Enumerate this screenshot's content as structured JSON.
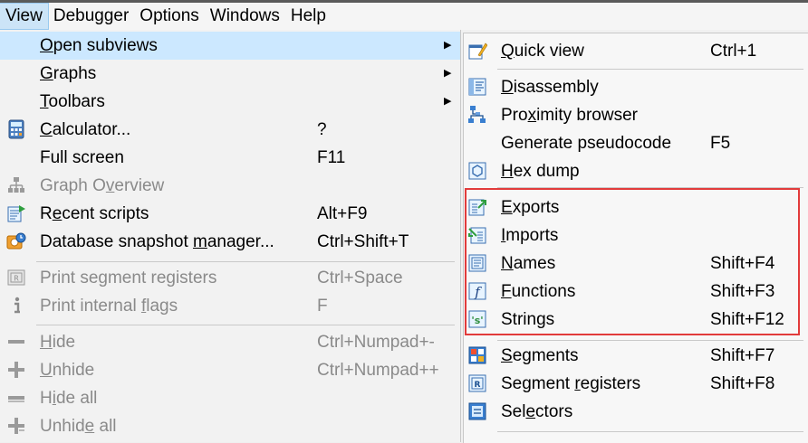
{
  "menubar": [
    {
      "label": "View",
      "active": true
    },
    {
      "label": "Debugger",
      "active": false
    },
    {
      "label": "Options",
      "active": false
    },
    {
      "label": "Windows",
      "active": false
    },
    {
      "label": "Help",
      "active": false
    }
  ],
  "view_menu": [
    {
      "label": "Open subviews",
      "pre": "",
      "u": "O",
      "post": "pen subviews",
      "shortcut": "",
      "submenu": true,
      "highlighted": true,
      "icon": "none-icon",
      "disabled": false
    },
    {
      "label": "Graphs",
      "pre": "",
      "u": "G",
      "post": "raphs",
      "shortcut": "",
      "submenu": true,
      "icon": "none-icon",
      "disabled": false
    },
    {
      "label": "Toolbars",
      "pre": "",
      "u": "T",
      "post": "oolbars",
      "shortcut": "",
      "submenu": true,
      "icon": "none-icon",
      "disabled": false
    },
    {
      "label": "Calculator...",
      "pre": "",
      "u": "C",
      "post": "alculator...",
      "shortcut": "?",
      "icon": "calculator-icon",
      "disabled": false
    },
    {
      "label": "Full screen",
      "pre": "Full screen",
      "u": "",
      "post": "",
      "shortcut": "F11",
      "icon": "none-icon",
      "disabled": false
    },
    {
      "label": "Graph Overview",
      "pre": "Graph O",
      "u": "v",
      "post": "erview",
      "shortcut": "",
      "icon": "graph-overview-icon",
      "disabled": true
    },
    {
      "label": "Recent scripts",
      "pre": "R",
      "u": "e",
      "post": "cent scripts",
      "shortcut": "Alt+F9",
      "icon": "recent-scripts-icon",
      "disabled": false
    },
    {
      "label": "Database snapshot manager...",
      "pre": "Database snapshot ",
      "u": "m",
      "post": "anager...",
      "shortcut": "Ctrl+Shift+T",
      "icon": "snapshot-manager-icon",
      "disabled": false
    },
    {
      "label": "Print segment registers",
      "pre": "Print segment registers",
      "u": "",
      "post": "",
      "shortcut": "Ctrl+Space",
      "icon": "print-segment-registers-icon",
      "disabled": true
    },
    {
      "label": "Print internal flags",
      "pre": "Print internal ",
      "u": "f",
      "post": "lags",
      "shortcut": "F",
      "icon": "info-icon",
      "disabled": true
    },
    {
      "label": "Hide",
      "pre": "",
      "u": "H",
      "post": "ide",
      "shortcut": "Ctrl+Numpad+-",
      "icon": "hide-icon",
      "disabled": true
    },
    {
      "label": "Unhide",
      "pre": "",
      "u": "U",
      "post": "nhide",
      "shortcut": "Ctrl+Numpad++",
      "icon": "unhide-icon",
      "disabled": true
    },
    {
      "label": "Hide all",
      "pre": "H",
      "u": "i",
      "post": "de all",
      "shortcut": "",
      "icon": "hide-all-icon",
      "disabled": true
    },
    {
      "label": "Unhide all",
      "pre": "Unhid",
      "u": "e",
      "post": " all",
      "shortcut": "",
      "icon": "unhide-all-icon",
      "disabled": true
    }
  ],
  "subviews_menu": [
    {
      "label": "Quick view",
      "pre": "",
      "u": "Q",
      "post": "uick view",
      "shortcut": "Ctrl+1",
      "icon": "quick-view-icon"
    },
    {
      "label": "Disassembly",
      "pre": "",
      "u": "D",
      "post": "isassembly",
      "shortcut": "",
      "icon": "disassembly-icon"
    },
    {
      "label": "Proximity browser",
      "pre": "Pro",
      "u": "x",
      "post": "imity browser",
      "shortcut": "",
      "icon": "proximity-browser-icon"
    },
    {
      "label": "Generate pseudocode",
      "pre": "Generate pseudocode",
      "u": "",
      "post": "",
      "shortcut": "F5",
      "icon": "none-icon"
    },
    {
      "label": "Hex dump",
      "pre": "",
      "u": "H",
      "post": "ex dump",
      "shortcut": "",
      "icon": "hex-dump-icon"
    },
    {
      "label": "Exports",
      "pre": "",
      "u": "E",
      "post": "xports",
      "shortcut": "",
      "icon": "exports-icon"
    },
    {
      "label": "Imports",
      "pre": "",
      "u": "I",
      "post": "mports",
      "shortcut": "",
      "icon": "imports-icon"
    },
    {
      "label": "Names",
      "pre": "",
      "u": "N",
      "post": "ames",
      "shortcut": "Shift+F4",
      "icon": "names-icon"
    },
    {
      "label": "Functions",
      "pre": "",
      "u": "F",
      "post": "unctions",
      "shortcut": "Shift+F3",
      "icon": "functions-icon"
    },
    {
      "label": "Strings",
      "pre": "Strin",
      "u": "g",
      "post": "s",
      "shortcut": "Shift+F12",
      "icon": "strings-icon"
    },
    {
      "label": "Segments",
      "pre": "",
      "u": "S",
      "post": "egments",
      "shortcut": "Shift+F7",
      "icon": "segments-icon"
    },
    {
      "label": "Segment registers",
      "pre": "Segment ",
      "u": "r",
      "post": "egisters",
      "shortcut": "Shift+F8",
      "icon": "segment-registers-icon"
    },
    {
      "label": "Selectors",
      "pre": "Sel",
      "u": "e",
      "post": "ctors",
      "shortcut": "",
      "icon": "selectors-icon"
    }
  ],
  "colors": {
    "highlight": "#cce8ff",
    "annotation_box": "#e23b3b",
    "disabled_text": "#8a8a8a"
  }
}
